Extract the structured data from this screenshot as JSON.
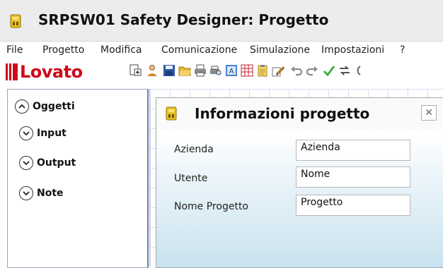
{
  "window": {
    "title": "SRPSW01 Safety Designer: Progetto"
  },
  "menu": [
    "File",
    "Progetto",
    "Modifica",
    "Comunicazione",
    "Simulazione",
    "Impostazioni",
    "?"
  ],
  "toolbar": {
    "logo_text": "Lovato",
    "brand_color": "#cc0a1a"
  },
  "sidebar": {
    "root": "Oggetti",
    "items": [
      "Input",
      "Output",
      "Note"
    ]
  },
  "dialog": {
    "title": "Informazioni progetto",
    "close_symbol": "✕",
    "fields": [
      {
        "label": "Azienda",
        "value": "Azienda"
      },
      {
        "label": "Utente",
        "value": "Nome"
      },
      {
        "label": "Nome Progetto",
        "value": "Progetto"
      }
    ]
  }
}
